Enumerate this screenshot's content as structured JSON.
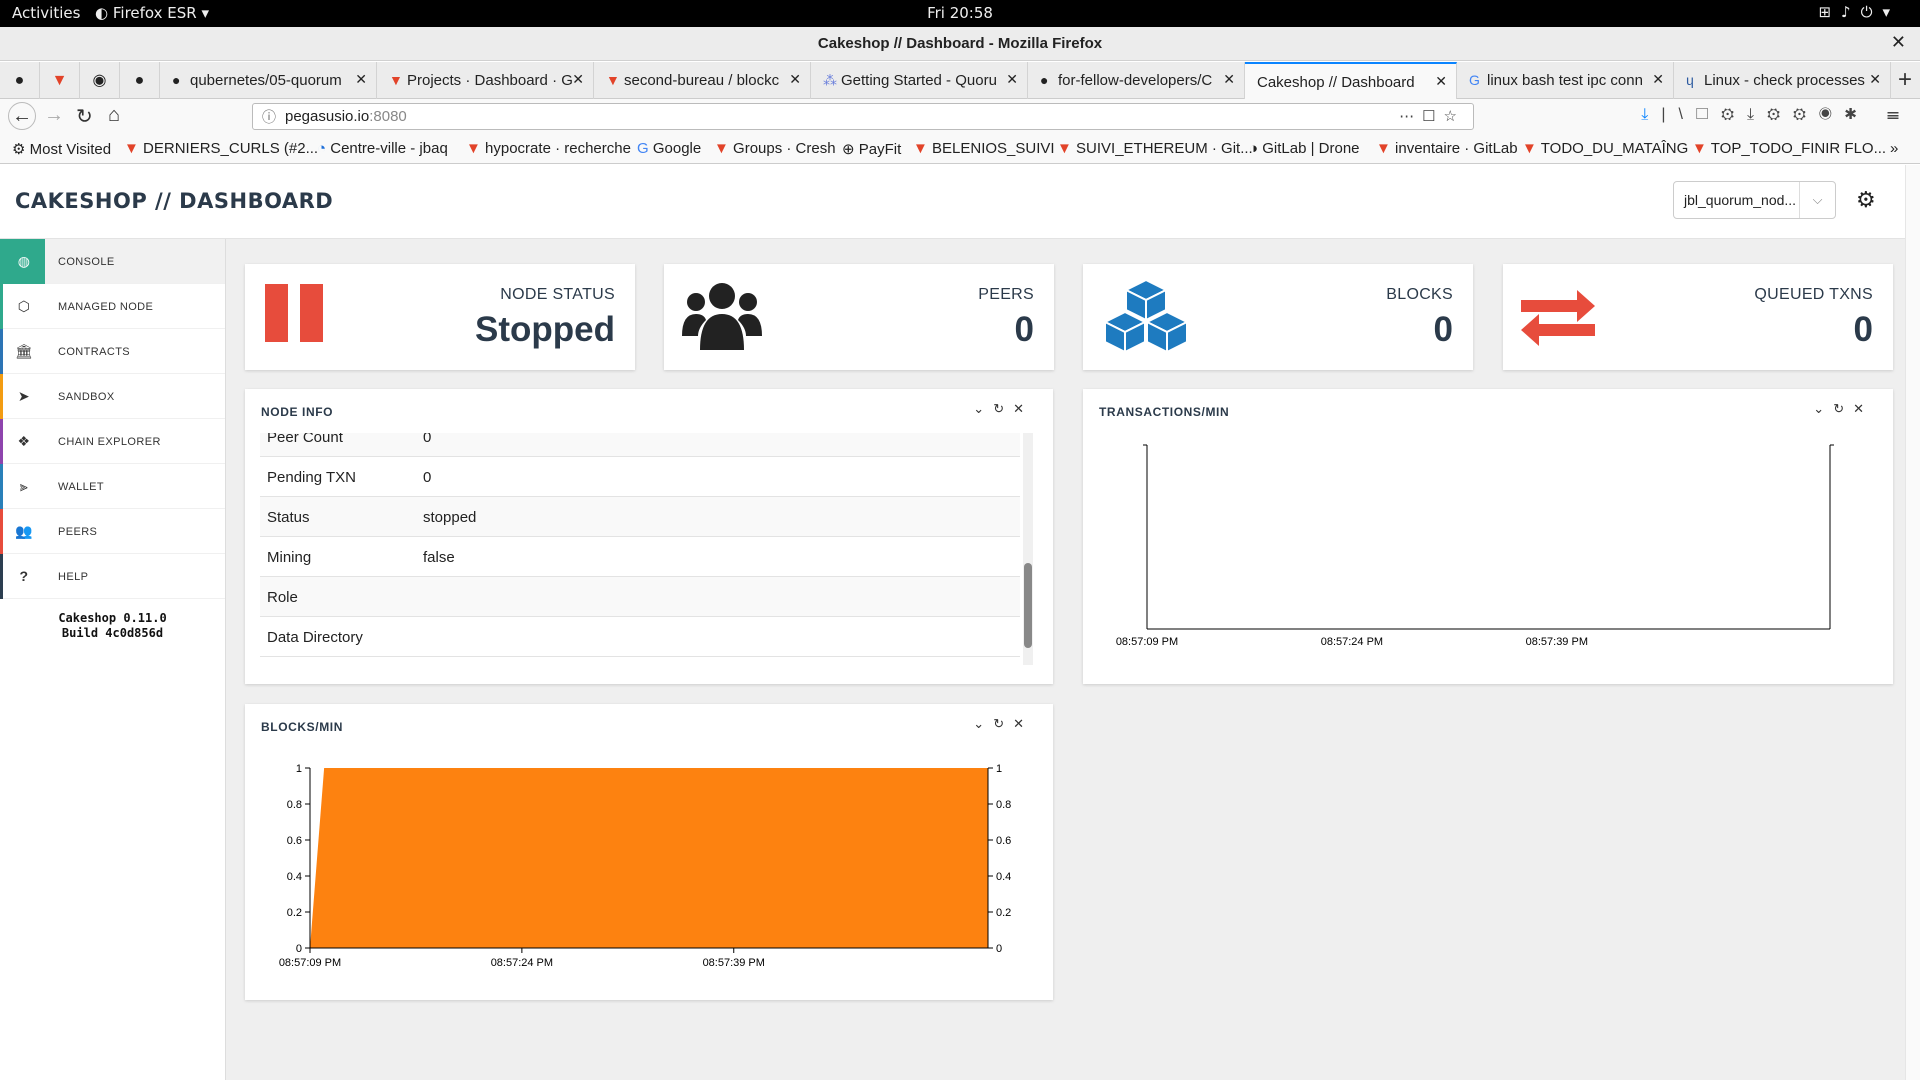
{
  "desktop": {
    "activities": "Activities",
    "app_menu": "Firefox ESR",
    "clock": "Fri 20:58"
  },
  "window": {
    "title": "Cakeshop // Dashboard - Mozilla Firefox"
  },
  "tabs": [
    {
      "label": "qubernetes/05-quorum"
    },
    {
      "label": "Projects · Dashboard · G"
    },
    {
      "label": "second-bureau / blockc"
    },
    {
      "label": "Getting Started - Quoru"
    },
    {
      "label": "for-fellow-developers/C"
    },
    {
      "label": "Cakeshop // Dashboard"
    },
    {
      "label": "linux bash test ipc conn"
    },
    {
      "label": "Linux - check processes"
    }
  ],
  "url": {
    "host": "pegasusio.io",
    "port": ":8080"
  },
  "bookmarks": [
    "Most Visited",
    "DERNIERS_CURLS (#2...",
    "Centre-ville - jbaq",
    "hypocrate · recherche",
    "Google",
    "Groups · Cresh",
    "PayFit",
    "BELENIOS_SUIVI",
    "SUIVI_ETHEREUM · Git...",
    "GitLab | Drone",
    "inventaire · GitLab",
    "TODO_DU_MATAÎNG",
    "TOP_TODO_FINIR FLO..."
  ],
  "header": {
    "title": "CAKESHOP // DASHBOARD",
    "node_select": "jbl_quorum_nod..."
  },
  "sidebar": {
    "items": [
      {
        "label": "CONSOLE",
        "icon": "dashboard-icon"
      },
      {
        "label": "MANAGED NODE",
        "icon": "cube-icon"
      },
      {
        "label": "CONTRACTS",
        "icon": "bank-icon"
      },
      {
        "label": "SANDBOX",
        "icon": "paper-plane-icon"
      },
      {
        "label": "CHAIN EXPLORER",
        "icon": "cubes-icon"
      },
      {
        "label": "WALLET",
        "icon": "wallet-icon"
      },
      {
        "label": "PEERS",
        "icon": "users-icon"
      },
      {
        "label": "HELP",
        "icon": "question-icon"
      }
    ],
    "version": "Cakeshop 0.11.0",
    "build": "Build 4c0d856d"
  },
  "stats": {
    "node_status": {
      "label": "NODE STATUS",
      "value": "Stopped"
    },
    "peers": {
      "label": "PEERS",
      "value": "0"
    },
    "blocks": {
      "label": "BLOCKS",
      "value": "0"
    },
    "queued": {
      "label": "QUEUED TXNS",
      "value": "0"
    }
  },
  "node_info": {
    "title": "NODE INFO",
    "rows": [
      {
        "key": "Peer Count",
        "value": "0"
      },
      {
        "key": "Pending TXN",
        "value": "0"
      },
      {
        "key": "Status",
        "value": "stopped"
      },
      {
        "key": "Mining",
        "value": "false"
      },
      {
        "key": "Role",
        "value": ""
      },
      {
        "key": "Data Directory",
        "value": ""
      }
    ]
  },
  "tx_panel": {
    "title": "TRANSACTIONS/MIN"
  },
  "blocks_panel": {
    "title": "BLOCKS/MIN"
  },
  "colors": {
    "accent": "#2fa98c",
    "status_red": "#e74c3c",
    "blocks_blue": "#1e7bc0",
    "area_orange": "#fd8210",
    "text_dark": "#2b3a4a"
  },
  "chart_data": [
    {
      "type": "line",
      "title": "TRANSACTIONS/MIN",
      "x_ticks": [
        "08:57:09 PM",
        "08:57:24 PM",
        "08:57:39 PM"
      ],
      "series": [],
      "grid": false
    },
    {
      "type": "area",
      "title": "BLOCKS/MIN",
      "x": [
        "08:57:09 PM",
        "08:57:10 PM",
        "08:57:57 PM"
      ],
      "x_ticks": [
        "08:57:09 PM",
        "08:57:24 PM",
        "08:57:39 PM"
      ],
      "y_ticks": [
        "0",
        "0.2",
        "0.4",
        "0.6",
        "0.8",
        "1"
      ],
      "series": [
        {
          "values": [
            0,
            1,
            1
          ]
        }
      ],
      "ylim": [
        0,
        1
      ],
      "grid": false
    }
  ]
}
